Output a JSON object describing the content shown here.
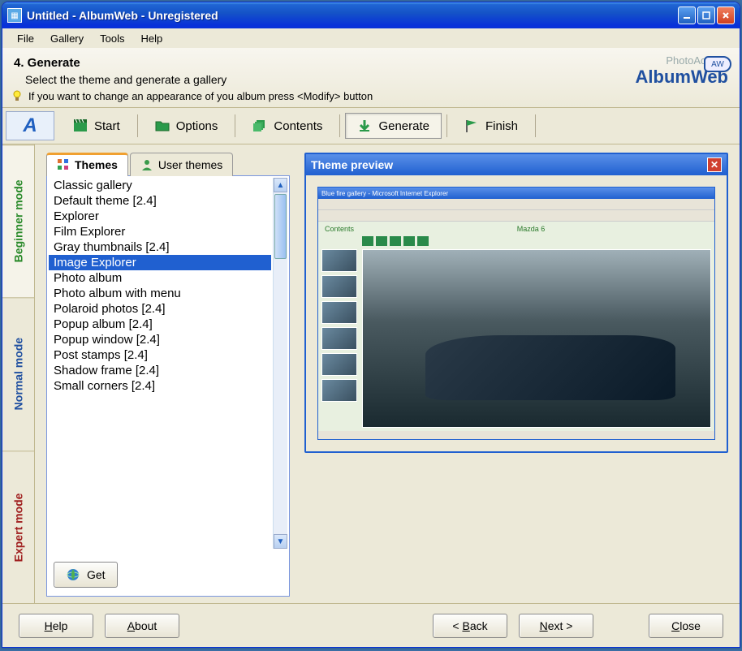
{
  "window": {
    "title": "Untitled - AlbumWeb - Unregistered"
  },
  "menu": {
    "file": "File",
    "gallery": "Gallery",
    "tools": "Tools",
    "help": "Help"
  },
  "header": {
    "step_title": "4. Generate",
    "step_desc": "Select the theme and generate a gallery",
    "tip": "If you want to change an appearance of you album press <Modify> button",
    "logo_top": "PhotoActions",
    "logo_main": "AlbumWeb",
    "logo_badge": "AW"
  },
  "toolbar": {
    "start": "Start",
    "options": "Options",
    "contents": "Contents",
    "generate": "Generate",
    "finish": "Finish"
  },
  "side_tabs": {
    "beginner": "Beginner mode",
    "normal": "Normal mode",
    "expert": "Expert mode"
  },
  "tabs": {
    "themes": "Themes",
    "user_themes": "User themes"
  },
  "themes": {
    "items": [
      "Classic gallery",
      "Default theme [2.4]",
      "Explorer",
      "Film Explorer",
      "Gray thumbnails [2.4]",
      "Image Explorer",
      "Photo album",
      "Photo album with menu",
      "Polaroid photos [2.4]",
      "Popup album [2.4]",
      "Popup window [2.4]",
      "Post stamps [2.4]",
      "Shadow frame [2.4]",
      "Small corners [2.4]"
    ],
    "selected_index": 5
  },
  "get_btn": "Get",
  "preview": {
    "title": "Theme preview",
    "ie_title": "Blue fire gallery - Microsoft Internet Explorer",
    "contents": "Contents",
    "photo_label": "Mazda 6"
  },
  "footer": {
    "help": "Help",
    "about": "About",
    "back": "< Back",
    "next": "Next >",
    "close": "Close"
  }
}
